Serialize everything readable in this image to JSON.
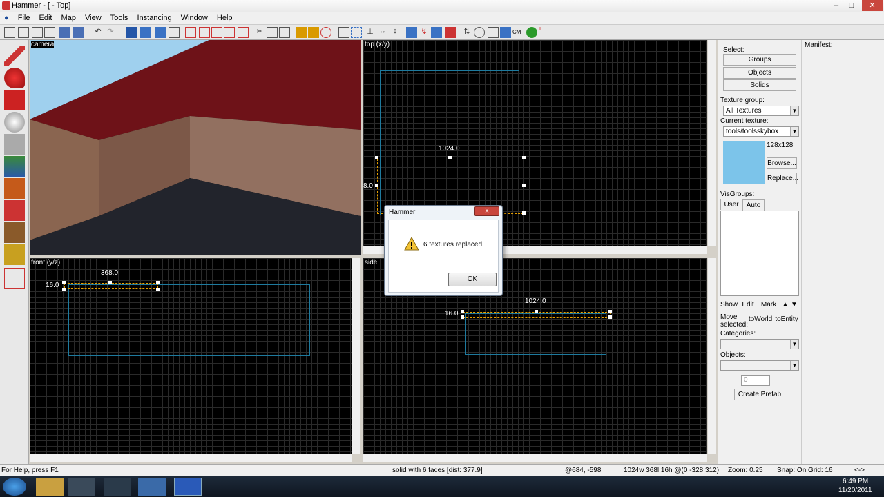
{
  "window": {
    "title": "Hammer - [ - Top]",
    "minimize": "–",
    "maximize": "□",
    "close": "✕"
  },
  "menu": [
    "File",
    "Edit",
    "Map",
    "View",
    "Tools",
    "Instancing",
    "Window",
    "Help"
  ],
  "viewports": {
    "camera": {
      "label": "camera"
    },
    "top": {
      "label": "top (x/y)",
      "dim_w": "1024.0",
      "dim_side": "8.0"
    },
    "front": {
      "label": "front (y/z)",
      "dim_w": "368.0",
      "dim_h": "16.0"
    },
    "side": {
      "label": "side",
      "dim_w": "1024.0",
      "dim_h": "16.0"
    }
  },
  "select_panel": {
    "select_label": "Select:",
    "groups": "Groups",
    "objects": "Objects",
    "solids": "Solids",
    "texture_group_label": "Texture group:",
    "texture_group_value": "All Textures",
    "current_texture_label": "Current texture:",
    "current_texture_value": "tools/toolsskybox",
    "texture_size": "128x128",
    "browse": "Browse...",
    "replace": "Replace...",
    "visgroups_label": "VisGroups:",
    "tab_user": "User",
    "tab_auto": "Auto",
    "show": "Show",
    "edit": "Edit",
    "mark": "Mark",
    "move_selected": "Move selected:",
    "to_world": "toWorld",
    "to_entity": "toEntity",
    "categories_label": "Categories:",
    "objects_label": "Objects:",
    "objects_count": "0",
    "create_prefab": "Create Prefab"
  },
  "manifest": {
    "label": "Manifest:"
  },
  "dialog": {
    "title": "Hammer",
    "message": "6 textures replaced.",
    "ok": "OK",
    "close": "x"
  },
  "status": {
    "help": "For Help, press F1",
    "selection": "solid with 6 faces  [dist: 377.9]",
    "coords": "@684, -598",
    "size": "1024w 368l 16h @(0 -328 312)",
    "zoom": "Zoom: 0.25",
    "snap": "Snap: On Grid: 16",
    "arrows": "<->"
  },
  "taskbar": {
    "time": "6:49 PM",
    "date": "11/20/2011"
  },
  "colors": {
    "selection_box": "#1e7a9e",
    "selection_dash": "#e8a000",
    "sky": "#9fd0ee",
    "ceiling": "#6e1218"
  }
}
